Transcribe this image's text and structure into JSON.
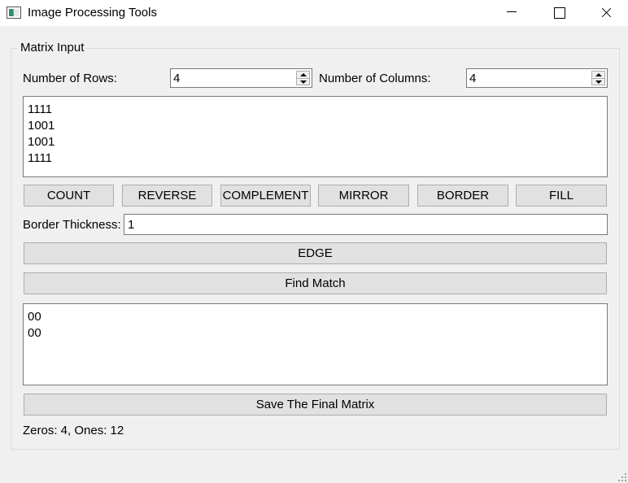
{
  "window": {
    "title": "Image Processing Tools"
  },
  "group": {
    "title": "Matrix Input"
  },
  "rows": {
    "label": "Number of Rows:",
    "value": "4"
  },
  "columns": {
    "label": "Number of Columns:",
    "value": "4"
  },
  "input_matrix": {
    "lines": [
      "1111",
      "1001",
      "1001",
      "1111"
    ]
  },
  "operations": [
    "COUNT",
    "REVERSE",
    "COMPLEMENT",
    "MIRROR",
    "BORDER",
    "FILL"
  ],
  "border": {
    "label": "Border Thickness:",
    "value": "1"
  },
  "edge_button": "EDGE",
  "find_match_button": "Find Match",
  "output_matrix": {
    "lines": [
      "00",
      "00"
    ]
  },
  "save_button": "Save The Final Matrix",
  "status": "Zeros: 4, Ones: 12"
}
